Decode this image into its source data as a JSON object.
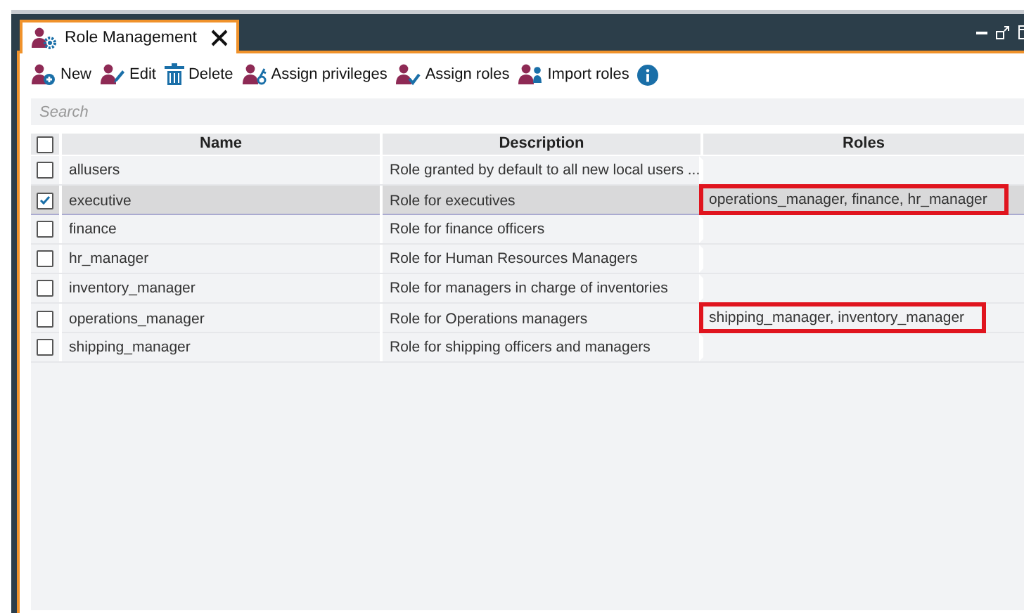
{
  "tab": {
    "title": "Role Management"
  },
  "toolbar": [
    {
      "kind": "new",
      "label": "New"
    },
    {
      "kind": "edit",
      "label": "Edit"
    },
    {
      "kind": "delete",
      "label": "Delete"
    },
    {
      "kind": "privileges",
      "label": "Assign privileges"
    },
    {
      "kind": "roles",
      "label": "Assign roles"
    },
    {
      "kind": "import",
      "label": "Import roles"
    },
    {
      "kind": "info"
    }
  ],
  "search": {
    "placeholder": "Search"
  },
  "table": {
    "all_checked": false,
    "columns": [
      "Name",
      "Description",
      "Roles"
    ],
    "rows": [
      {
        "name": "allusers",
        "description": "Role granted by default to all new local users ...",
        "checked": false,
        "selected": false,
        "highlighted": false
      },
      {
        "name": "executive",
        "description": "Role for executives",
        "roles": "operations_manager, finance, hr_manager",
        "checked": true,
        "selected": true,
        "highlighted": true
      },
      {
        "name": "finance",
        "description": "Role for finance officers",
        "checked": false,
        "selected": false,
        "highlighted": false
      },
      {
        "name": "hr_manager",
        "description": "Role for Human Resources Managers",
        "checked": false,
        "selected": false,
        "highlighted": false
      },
      {
        "name": "inventory_manager",
        "description": "Role for managers in charge of inventories",
        "checked": false,
        "selected": false,
        "highlighted": false
      },
      {
        "name": "operations_manager",
        "description": "Role for Operations managers",
        "roles": "shipping_manager, inventory_manager",
        "checked": false,
        "selected": false,
        "highlighted": true
      },
      {
        "name": "shipping_manager",
        "description": "Role for shipping officers and managers",
        "checked": false,
        "selected": false,
        "highlighted": false
      }
    ]
  }
}
